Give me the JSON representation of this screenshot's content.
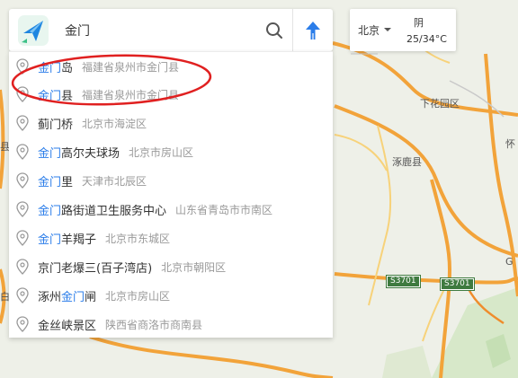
{
  "search": {
    "query": "金门",
    "placeholder": ""
  },
  "suggestions": [
    {
      "pre": "",
      "hl": "金门",
      "post": "岛",
      "address": "福建省泉州市金门县"
    },
    {
      "pre": "",
      "hl": "金门",
      "post": "县",
      "address": "福建省泉州市金门县"
    },
    {
      "pre": "蓟门桥",
      "hl": "",
      "post": "",
      "address": "北京市海淀区"
    },
    {
      "pre": "",
      "hl": "金门",
      "post": "高尔夫球场",
      "address": "北京市房山区"
    },
    {
      "pre": "",
      "hl": "金门",
      "post": "里",
      "address": "天津市北辰区"
    },
    {
      "pre": "",
      "hl": "金门",
      "post": "路街道卫生服务中心",
      "address": "山东省青岛市市南区"
    },
    {
      "pre": "",
      "hl": "金门",
      "post": "羊羯子",
      "address": "北京市东城区"
    },
    {
      "pre": "京门老爆三(百子湾店)",
      "hl": "",
      "post": "",
      "address": "北京市朝阳区"
    },
    {
      "pre": "涿州",
      "hl": "金门",
      "post": "闸",
      "address": "北京市房山区"
    },
    {
      "pre": "金丝峡景区",
      "hl": "",
      "post": "",
      "address": "陕西省商洛市商南县"
    }
  ],
  "city_widget": {
    "city": "北京",
    "condition": "阴",
    "temperature": "25/34°C"
  },
  "map": {
    "labels": {
      "xiahuayuan": "下花园区",
      "zhuolu": "涿鹿县",
      "s3701_a": "S3701",
      "s3701_b": "S3701",
      "edge_huai": "怀",
      "edge_g": "G",
      "edge_xian": "县",
      "edge_bai": "白"
    }
  },
  "colors": {
    "highlight": "#2b7de9",
    "annotation": "#e02020",
    "road_major": "#f2a33a",
    "road_minor": "#f7d27a",
    "shield": "#3e7a3f"
  },
  "icons": {
    "logo": "paper-plane-logo",
    "search": "magnifier-icon",
    "route": "route-arrow-icon",
    "pin": "location-pin-icon"
  }
}
